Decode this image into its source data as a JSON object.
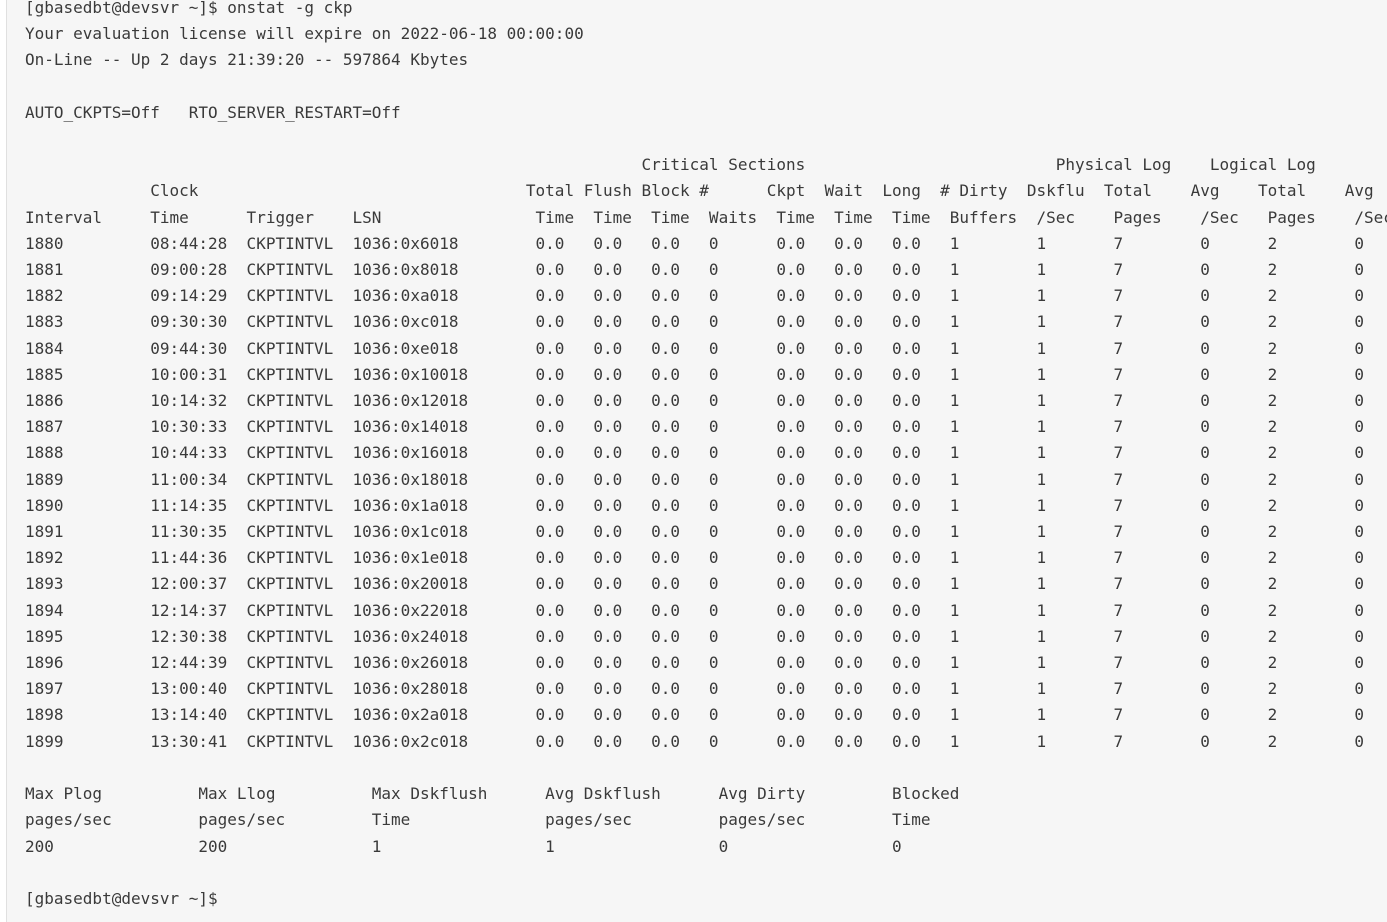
{
  "terminal": {
    "lines": [
      "[gbasedbt@devsvr ~]$ onstat -g ckp",
      "Your evaluation license will expire on 2022-06-18 00:00:00",
      "On-Line -- Up 2 days 21:39:20 -- 597864 Kbytes",
      "",
      "AUTO_CKPTS=Off   RTO_SERVER_RESTART=Off",
      "",
      "                                                                Critical Sections                          Physical Log    Logical Log",
      "             Clock                                  Total Flush Block #      Ckpt  Wait  Long  # Dirty  Dskflu  Total    Avg    Total    Avg",
      "Interval     Time      Trigger    LSN                Time  Time  Time  Waits  Time  Time  Time  Buffers  /Sec    Pages    /Sec   Pages    /Sec",
      "1880         08:44:28  CKPTINTVL  1036:0x6018        0.0   0.0   0.0   0      0.0   0.0   0.0   1        1       7        0      2        0",
      "1881         09:00:28  CKPTINTVL  1036:0x8018        0.0   0.0   0.0   0      0.0   0.0   0.0   1        1       7        0      2        0",
      "1882         09:14:29  CKPTINTVL  1036:0xa018        0.0   0.0   0.0   0      0.0   0.0   0.0   1        1       7        0      2        0",
      "1883         09:30:30  CKPTINTVL  1036:0xc018        0.0   0.0   0.0   0      0.0   0.0   0.0   1        1       7        0      2        0",
      "1884         09:44:30  CKPTINTVL  1036:0xe018        0.0   0.0   0.0   0      0.0   0.0   0.0   1        1       7        0      2        0",
      "1885         10:00:31  CKPTINTVL  1036:0x10018       0.0   0.0   0.0   0      0.0   0.0   0.0   1        1       7        0      2        0",
      "1886         10:14:32  CKPTINTVL  1036:0x12018       0.0   0.0   0.0   0      0.0   0.0   0.0   1        1       7        0      2        0",
      "1887         10:30:33  CKPTINTVL  1036:0x14018       0.0   0.0   0.0   0      0.0   0.0   0.0   1        1       7        0      2        0",
      "1888         10:44:33  CKPTINTVL  1036:0x16018       0.0   0.0   0.0   0      0.0   0.0   0.0   1        1       7        0      2        0",
      "1889         11:00:34  CKPTINTVL  1036:0x18018       0.0   0.0   0.0   0      0.0   0.0   0.0   1        1       7        0      2        0",
      "1890         11:14:35  CKPTINTVL  1036:0x1a018       0.0   0.0   0.0   0      0.0   0.0   0.0   1        1       7        0      2        0",
      "1891         11:30:35  CKPTINTVL  1036:0x1c018       0.0   0.0   0.0   0      0.0   0.0   0.0   1        1       7        0      2        0",
      "1892         11:44:36  CKPTINTVL  1036:0x1e018       0.0   0.0   0.0   0      0.0   0.0   0.0   1        1       7        0      2        0",
      "1893         12:00:37  CKPTINTVL  1036:0x20018       0.0   0.0   0.0   0      0.0   0.0   0.0   1        1       7        0      2        0",
      "1894         12:14:37  CKPTINTVL  1036:0x22018       0.0   0.0   0.0   0      0.0   0.0   0.0   1        1       7        0      2        0",
      "1895         12:30:38  CKPTINTVL  1036:0x24018       0.0   0.0   0.0   0      0.0   0.0   0.0   1        1       7        0      2        0",
      "1896         12:44:39  CKPTINTVL  1036:0x26018       0.0   0.0   0.0   0      0.0   0.0   0.0   1        1       7        0      2        0",
      "1897         13:00:40  CKPTINTVL  1036:0x28018       0.0   0.0   0.0   0      0.0   0.0   0.0   1        1       7        0      2        0",
      "1898         13:14:40  CKPTINTVL  1036:0x2a018       0.0   0.0   0.0   0      0.0   0.0   0.0   1        1       7        0      2        0",
      "1899         13:30:41  CKPTINTVL  1036:0x2c018       0.0   0.0   0.0   0      0.0   0.0   0.0   1        1       7        0      2        0",
      "",
      "Max Plog          Max Llog          Max Dskflush      Avg Dskflush      Avg Dirty         Blocked",
      "pages/sec         pages/sec         Time              pages/sec         pages/sec         Time",
      "200               200               1                 1                 0                 0",
      "",
      "[gbasedbt@devsvr ~]$"
    ]
  }
}
